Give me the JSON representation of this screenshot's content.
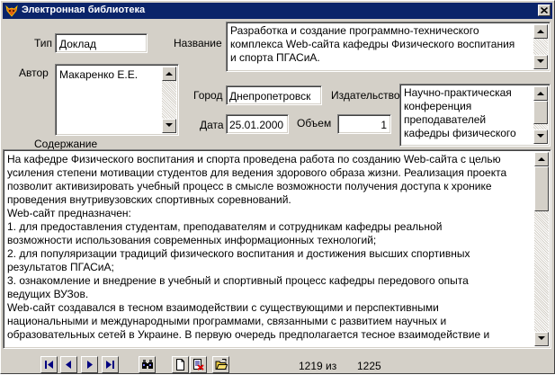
{
  "window": {
    "title": "Электронная библиотека",
    "title_icon": "fox-app-icon",
    "close_icon": "close-icon"
  },
  "labels": {
    "type": "Тип",
    "title": "Название",
    "author": "Автор",
    "city": "Город",
    "publisher": "Издательство",
    "date": "Дата",
    "volume": "Объем",
    "content": "Содержание"
  },
  "fields": {
    "type": "Доклад",
    "title_lines": [
      "Разработка и создание программно-технического",
      "комплекса Web-сайта кафедры Физического воспитания",
      "и спорта ПГАСиА."
    ],
    "author": "Макаренко Е.Е.",
    "city": "Днепропетровск",
    "publisher_lines": [
      "Научно-практическая",
      "конференция",
      "преподавателей",
      "кафедры физического"
    ],
    "date": "25.01.2000",
    "volume": "1"
  },
  "content_lines": [
    "На кафедре Физического воспитания и спорта проведена работа по созданию Web-сайта с целью",
    "усиления степени мотивации студентов для ведения здорового образа жизни. Реализация проекта",
    "позволит активизировать учебный процесс в смысле возможности получения доступа к хронике",
    "проведения внутривузовских спортивных соревнований.",
    "Web-сайт предназначен:",
    "1. для предоставления студентам, преподавателям и сотрудникам кафедры реальной",
    "возможности использования современных информационных технологий;",
    "2. для популяризации традиций физического воспитания и достижения высших спортивных",
    "результатов ПГАСиА;",
    "3. ознакомление и внедрение в учебный и спортивный процесс кафедры передового опыта",
    "ведущих ВУЗов.",
    "Web-сайт создавался в тесном взаимодействии с существующими и перспективными",
    "национальными и международными программами, связанными с развитием научных и",
    "образовательных сетей в Украине. В первую очередь предполагается тесное взаимодействие и"
  ],
  "navbar": {
    "record_current": "1219 из",
    "record_total": "1225",
    "icons": [
      "first-record-icon",
      "prev-record-icon",
      "next-record-icon",
      "last-record-icon",
      "search-binoculars-icon",
      "new-record-icon",
      "delete-record-icon",
      "open-folder-icon"
    ]
  }
}
